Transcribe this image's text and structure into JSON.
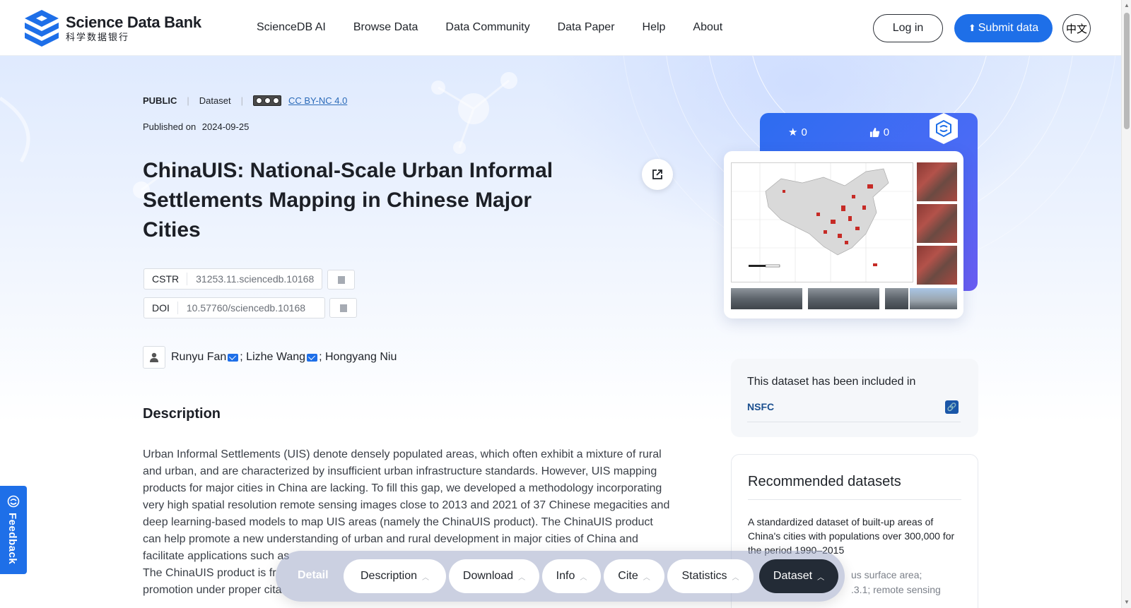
{
  "header": {
    "logo_en": "Science Data Bank",
    "logo_zh": "科学数据银行",
    "nav": [
      "ScienceDB AI",
      "Browse Data",
      "Data Community",
      "Data Paper",
      "Help",
      "About"
    ],
    "login_label": "Log in",
    "submit_label": "Submit data",
    "lang_label": "中文"
  },
  "dataset": {
    "status": "PUBLIC",
    "type": "Dataset",
    "license": "CC BY-NC 4.0",
    "published_label": "Published on",
    "published_date": "2024-09-25",
    "title": "ChinaUIS: National-Scale Urban Informal Settlements Mapping in Chinese Major Cities",
    "cstr_label": "CSTR",
    "cstr_value": "31253.11.sciencedb.10168",
    "doi_label": "DOI",
    "doi_value": "10.57760/sciencedb.10168",
    "authors": [
      "Runyu Fan",
      "Lizhe Wang",
      "Hongyang Niu"
    ],
    "author_sep": ";"
  },
  "description": {
    "heading": "Description",
    "lines": [
      "Urban Informal Settlements (UIS) denote densely populated areas, which often exhibit a mixture of rural",
      "and urban, and are characterized by insufficient urban infrastructure standards. However, UIS mapping",
      "products for major cities in China are lacking. To fill this gap, we developed a methodology incorporating",
      "very high spatial resolution remote sensing images close to 2013 and 2021 of 37 Chinese megacities and",
      "deep learning-based models to map UIS areas (namely the ChinaUIS product). The ChinaUIS product",
      "can help promote a new understanding of urban and rural development in major cities of China and",
      "facilitate applications such as",
      "The ChinaUIS product is fr",
      "promotion under proper cita"
    ]
  },
  "card": {
    "stars": "0",
    "likes": "0"
  },
  "included": {
    "text": "This dataset has been included in",
    "name": "NSFC"
  },
  "recommended": {
    "heading": "Recommended datasets",
    "item_title": "A standardized dataset of built-up areas of China's cities with populations over 300,000 for the period 1990–2015",
    "item_keywords_1": "us surface area;",
    "item_keywords_2": ".3.1; remote sensing"
  },
  "feedback_label": "Feedback",
  "bottom_bar": {
    "detail_label": "Detail",
    "tabs": [
      "Description",
      "Download",
      "Info",
      "Cite",
      "Statistics",
      "Dataset"
    ],
    "active_tab": "Dataset"
  },
  "colors": {
    "primary": "#1e6fe8",
    "title_dark": "#1c1f26",
    "link": "#2a6ab8"
  }
}
